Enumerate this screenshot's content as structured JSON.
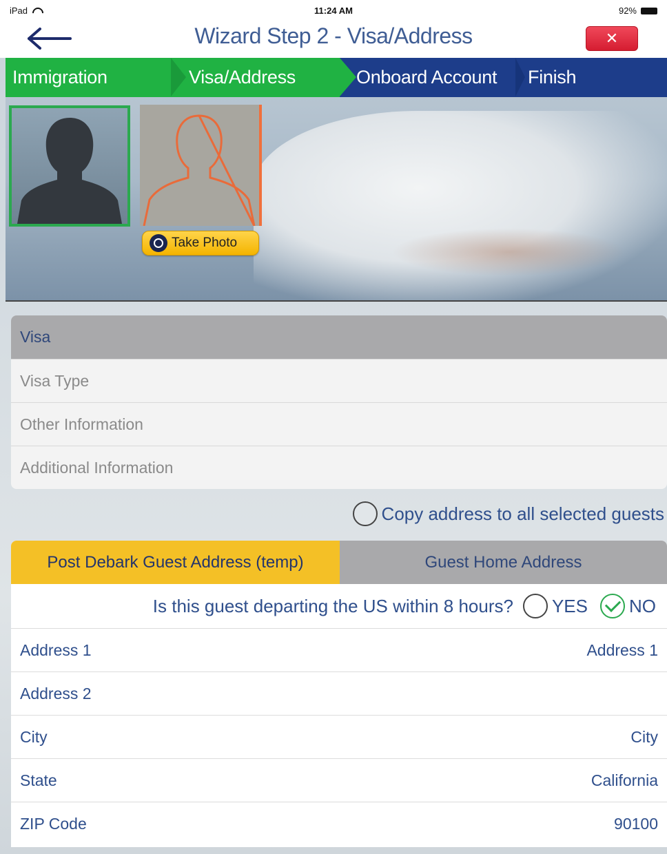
{
  "status_bar": {
    "device": "iPad",
    "time": "11:24 AM",
    "battery": "92%"
  },
  "header": {
    "title": "Wizard Step 2 - Visa/Address",
    "close_label": "✕"
  },
  "wizard_steps": [
    {
      "label": "Immigration",
      "state": "done"
    },
    {
      "label": "Visa/Address",
      "state": "current"
    },
    {
      "label": "Onboard Account",
      "state": "pending"
    },
    {
      "label": "Finish",
      "state": "pending"
    }
  ],
  "photo": {
    "take_photo_label": "Take Photo"
  },
  "visa": {
    "header": "Visa",
    "rows": [
      {
        "placeholder": "Visa Type"
      },
      {
        "placeholder": "Other Information"
      },
      {
        "placeholder": "Additional Information"
      }
    ]
  },
  "copy_address": {
    "label": "Copy address to all selected guests",
    "checked": false
  },
  "address": {
    "tabs": [
      {
        "label": "Post Debark Guest Address (temp)",
        "active": true
      },
      {
        "label": "Guest Home Address",
        "active": false
      }
    ],
    "departing_question": "Is this guest departing the US within 8 hours?",
    "yes_label": "YES",
    "no_label": "NO",
    "selected": "NO",
    "fields": [
      {
        "label": "Address 1",
        "value": "Address 1"
      },
      {
        "label": "Address 2",
        "value": ""
      },
      {
        "label": "City",
        "value": "City"
      },
      {
        "label": "State",
        "value": "California"
      },
      {
        "label": "ZIP Code",
        "value": "90100"
      }
    ]
  },
  "colors": {
    "step_done": "#20b243",
    "step_pending": "#1d3d8a",
    "tab_active": "#f4c026",
    "text_blue": "#2f4f8c",
    "close_red": "#d51d31"
  }
}
